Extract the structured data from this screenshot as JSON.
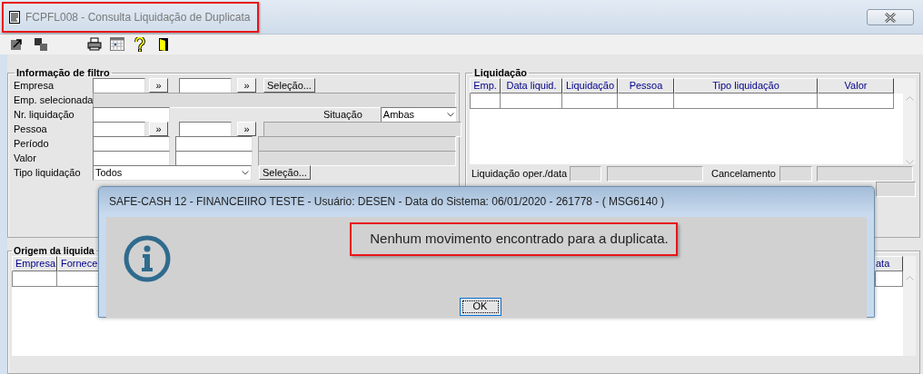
{
  "window": {
    "title": "FCPFL008 - Consulta Liquidação de Duplicata"
  },
  "filter": {
    "title": "Informação de filtro",
    "rows": [
      {
        "kind": "range_lookup",
        "label": "Empresa",
        "arrow": "»",
        "arrow_2": "»",
        "button": "Seleção..."
      },
      {
        "kind": "display",
        "label": "Emp. selecionada"
      },
      {
        "kind": "single",
        "label": "Nr. liquidação",
        "extra_label": "Situação",
        "select": "Ambas"
      },
      {
        "kind": "range_lookup",
        "label": "Pessoa",
        "arrow": "»",
        "arrow_2": "»"
      },
      {
        "kind": "range",
        "label": "Período"
      },
      {
        "kind": "range",
        "label": "Valor"
      },
      {
        "kind": "select",
        "label": "Tipo liquidação",
        "value": "Todos",
        "button": "Seleção..."
      }
    ]
  },
  "liquidacao": {
    "title": "Liquidação",
    "columns": [
      "Emp.",
      "Data liquid.",
      "Liquidação",
      "Pessoa",
      "Tipo liquidação",
      "Valor"
    ],
    "footer": {
      "label": "Liquidação oper./data",
      "label_2": "Cancelamento"
    }
  },
  "origem": {
    "title": "Origem da liquida",
    "columns": [
      "Empresa",
      "Fornece"
    ],
    "column_3": "ata"
  },
  "dialog": {
    "title": "SAFE-CASH 12 - FINANCEIIRO TESTE - Usuário: DESEN - Data do Sistema: 06/01/2020 - 261778 - ( MSG6140 )",
    "message": "Nenhum movimento encontrado para a duplicata.",
    "button": "OK"
  }
}
